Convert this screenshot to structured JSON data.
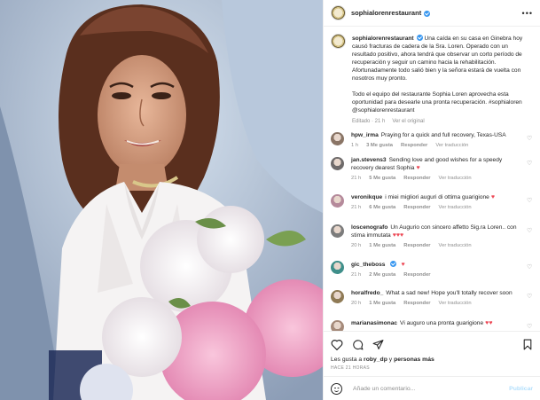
{
  "post": {
    "username": "sophialorenrestaurant",
    "more_label": "•••"
  },
  "caption": {
    "username": "sophialorenrestaurant",
    "paragraph1": "Una caída en su casa en Ginebra hoy causó fracturas de cadera de la Sra. Loren. Operado con un resultado positivo, ahora tendrá que observar un corto período de recuperación y seguir un camino hacia la rehabilitación. Afortunadamente todo salió bien y la señora estará de vuelta con nosotros muy pronto.",
    "paragraph2": "Todo el equipo del restaurante Sophia Loren aprovecha esta oportunidad para desearle una pronta recuperación. #sophialoren @sophialorenrestaurant",
    "edited": "Editado · 21 h",
    "see_original": "Ver el original"
  },
  "comments": [
    {
      "user": "hpw_irma",
      "text": "Praying for a quick and full recovery, Texas-USA",
      "time": "1 h",
      "likes": "3 Me gusta",
      "reply": "Responder",
      "translate": "Ver traducción",
      "color": "#8a7566"
    },
    {
      "user": "jan.stevens3",
      "text": "Sending love and good wishes for a speedy recovery dearest Sophia",
      "heart": "♥",
      "time": "21 h",
      "likes": "5 Me gusta",
      "reply": "Responder",
      "translate": "Ver traducción",
      "color": "#6e6a6a"
    },
    {
      "user": "veronikque",
      "text": "i miei migliori auguri di ottima guarigione",
      "heart": "♥",
      "time": "21 h",
      "likes": "6 Me gusta",
      "reply": "Responder",
      "translate": "Ver traducción",
      "color": "#b58a9b"
    },
    {
      "user": "loscenografo",
      "text": "Un Augurio con sincero affetto Sig.ra Loren.. con stima immutata",
      "heart": "♥♥♥",
      "time": "20 h",
      "likes": "1 Me gusta",
      "reply": "Responder",
      "translate": "Ver traducción",
      "color": "#7c7c7c"
    },
    {
      "user": "gic_theboss",
      "text": "",
      "heart": "♥",
      "time": "21 h",
      "likes": "2 Me gusta",
      "reply": "Responder",
      "color": "#3f8f8a"
    },
    {
      "user": "horalfredo_",
      "text": "What a sad new! Hope you'll totally recover soon",
      "time": "20 h",
      "likes": "1 Me gusta",
      "reply": "Responder",
      "translate": "Ver traducción",
      "color": "#8f7a55"
    },
    {
      "user": "marianasimonac",
      "text": "Vi auguro una pronta guarigione",
      "heart": "♥♥",
      "time": "",
      "likes": "",
      "reply": "",
      "translate": "",
      "color": "#a58a7a"
    }
  ],
  "footer": {
    "likes_prefix": "Les gusta a",
    "liker": "roby_dp",
    "likes_mid": "y",
    "others": "personas más",
    "time_ago": "HACE 21 HORAS",
    "comment_placeholder": "Añade un comentario...",
    "publish": "Publicar"
  },
  "colors": {
    "accent_blue": "#3897f0",
    "heart_red": "#ed4956",
    "muted": "#8e8e8e"
  }
}
